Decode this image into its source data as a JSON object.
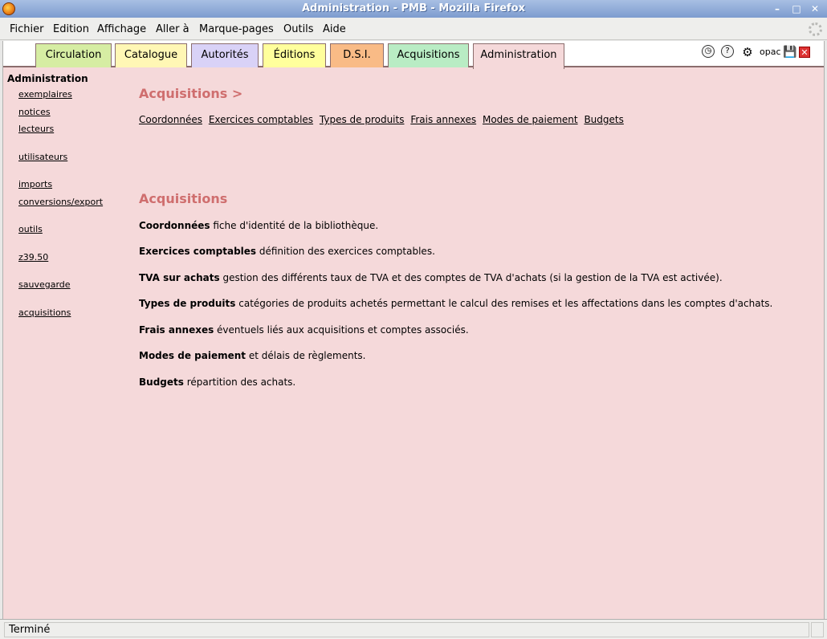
{
  "window": {
    "title": "Administration - PMB - Mozilla Firefox"
  },
  "menubar": {
    "items": [
      "Fichier",
      "Edition",
      "Affichage",
      "Aller à",
      "Marque-pages",
      "Outils",
      "Aide"
    ]
  },
  "tabs": [
    {
      "label": "Circulation",
      "color": "#d6eda3"
    },
    {
      "label": "Catalogue",
      "color": "#fff7b5"
    },
    {
      "label": "Autorités",
      "color": "#d9d2f7"
    },
    {
      "label": "Éditions",
      "color": "#ffff9c"
    },
    {
      "label": "D.S.I.",
      "color": "#f9bb86"
    },
    {
      "label": "Acquisitions",
      "color": "#b9ecc4"
    },
    {
      "label": "Administration",
      "color": "#f5d9da",
      "active": true
    }
  ],
  "toolbar": {
    "opac_label": "opac",
    "icons": [
      "clock-icon",
      "help-icon",
      "gear-icon",
      "opac-icon",
      "save-icon",
      "close-icon"
    ]
  },
  "leftmenu": {
    "title": "Administration",
    "items": [
      "exemplaires",
      "notices",
      "lecteurs",
      "utilisateurs",
      "imports",
      "conversions/export",
      "outils",
      "z39.50",
      "sauvegarde",
      "acquisitions"
    ]
  },
  "main": {
    "breadcrumb": "Acquisitions >",
    "sublinks": [
      "Coordonnées",
      "Exercices comptables",
      "Types de produits",
      "Frais annexes",
      "Modes de paiement",
      "Budgets"
    ],
    "section_title": "Acquisitions",
    "descriptions": [
      {
        "term": "Coordonnées",
        "text": " fiche d'identité de la bibliothèque."
      },
      {
        "term": "Exercices comptables",
        "text": " définition des exercices comptables."
      },
      {
        "term": "TVA sur achats",
        "text": " gestion des différents taux de TVA et des comptes de TVA d'achats (si la gestion de la TVA est activée)."
      },
      {
        "term": "Types de produits",
        "text": " catégories de produits achetés permettant le calcul des remises et les affectations dans les comptes d'achats."
      },
      {
        "term": "Frais annexes",
        "text": " éventuels liés aux acquisitions et comptes associés."
      },
      {
        "term": "Modes de paiement",
        "text": " et délais de règlements."
      },
      {
        "term": "Budgets",
        "text": " répartition des achats."
      }
    ]
  },
  "status": {
    "text": "Terminé"
  },
  "colors": {
    "page_bg": "#f5d9da",
    "heading": "#cf6e6e",
    "tab_border": "#8b6d6d"
  }
}
